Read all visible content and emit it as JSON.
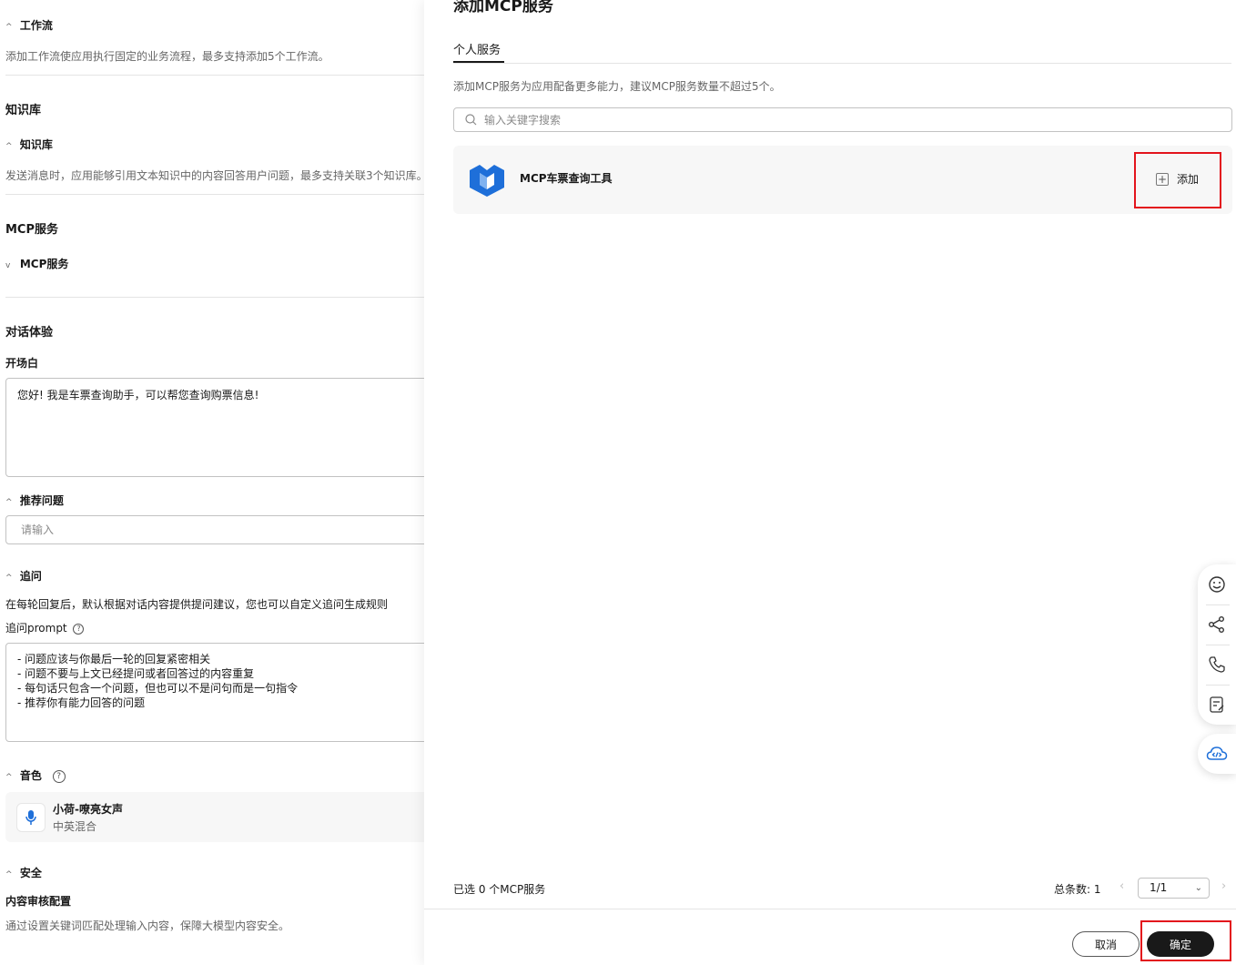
{
  "left": {
    "workflow": {
      "title": "工作流",
      "desc": "添加工作流使应用执行固定的业务流程，最多支持添加5个工作流。"
    },
    "knowledge": {
      "section_title": "知识库",
      "sub_title": "知识库",
      "desc": "发送消息时，应用能够引用文本知识中的内容回答用户问题，最多支持关联3个知识库。"
    },
    "mcp": {
      "section_title": "MCP服务",
      "sub_title": "MCP服务"
    },
    "chat": {
      "section_title": "对话体验",
      "opening_label": "开场白",
      "opening_text": "您好! 我是车票查询助手，可以帮您查询购票信息!",
      "suggest_title": "推荐问题",
      "suggest_placeholder": "请输入",
      "followup_title": "追问",
      "followup_desc": "在每轮回复后，默认根据对话内容提供提问建议，您也可以自定义追问生成规则",
      "followup_prompt_label": "追问prompt",
      "followup_prompt_lines": [
        "- 问题应该与你最后一轮的回复紧密相关",
        "- 问题不要与上文已经提问或者回答过的内容重复",
        "- 每句话只包含一个问题，但也可以不是问句而是一句指令",
        "- 推荐你有能力回答的问题"
      ],
      "voice_title": "音色",
      "voice_name": "小荷-嘹亮女声",
      "voice_desc": "中英混合"
    },
    "security": {
      "title": "安全",
      "audit_title": "内容审核配置",
      "audit_desc": "通过设置关键词匹配处理输入内容，保障大模型内容安全。"
    }
  },
  "drawer": {
    "title": "添加MCP服务",
    "tab": "个人服务",
    "desc": "添加MCP服务为应用配备更多能力，建议MCP服务数量不超过5个。",
    "search_placeholder": "输入关键字搜索",
    "services": [
      {
        "name": "MCP车票查询工具",
        "action": "添加"
      }
    ],
    "selected_count": "已选 0 个MCP服务",
    "total_label": "总条数: 1",
    "page": "1/1",
    "cancel": "取消",
    "confirm": "确定"
  },
  "colors": {
    "highlight_frame": "#e3141c",
    "primary_button": "#191919",
    "logo_blue": "#1e6fd9"
  }
}
